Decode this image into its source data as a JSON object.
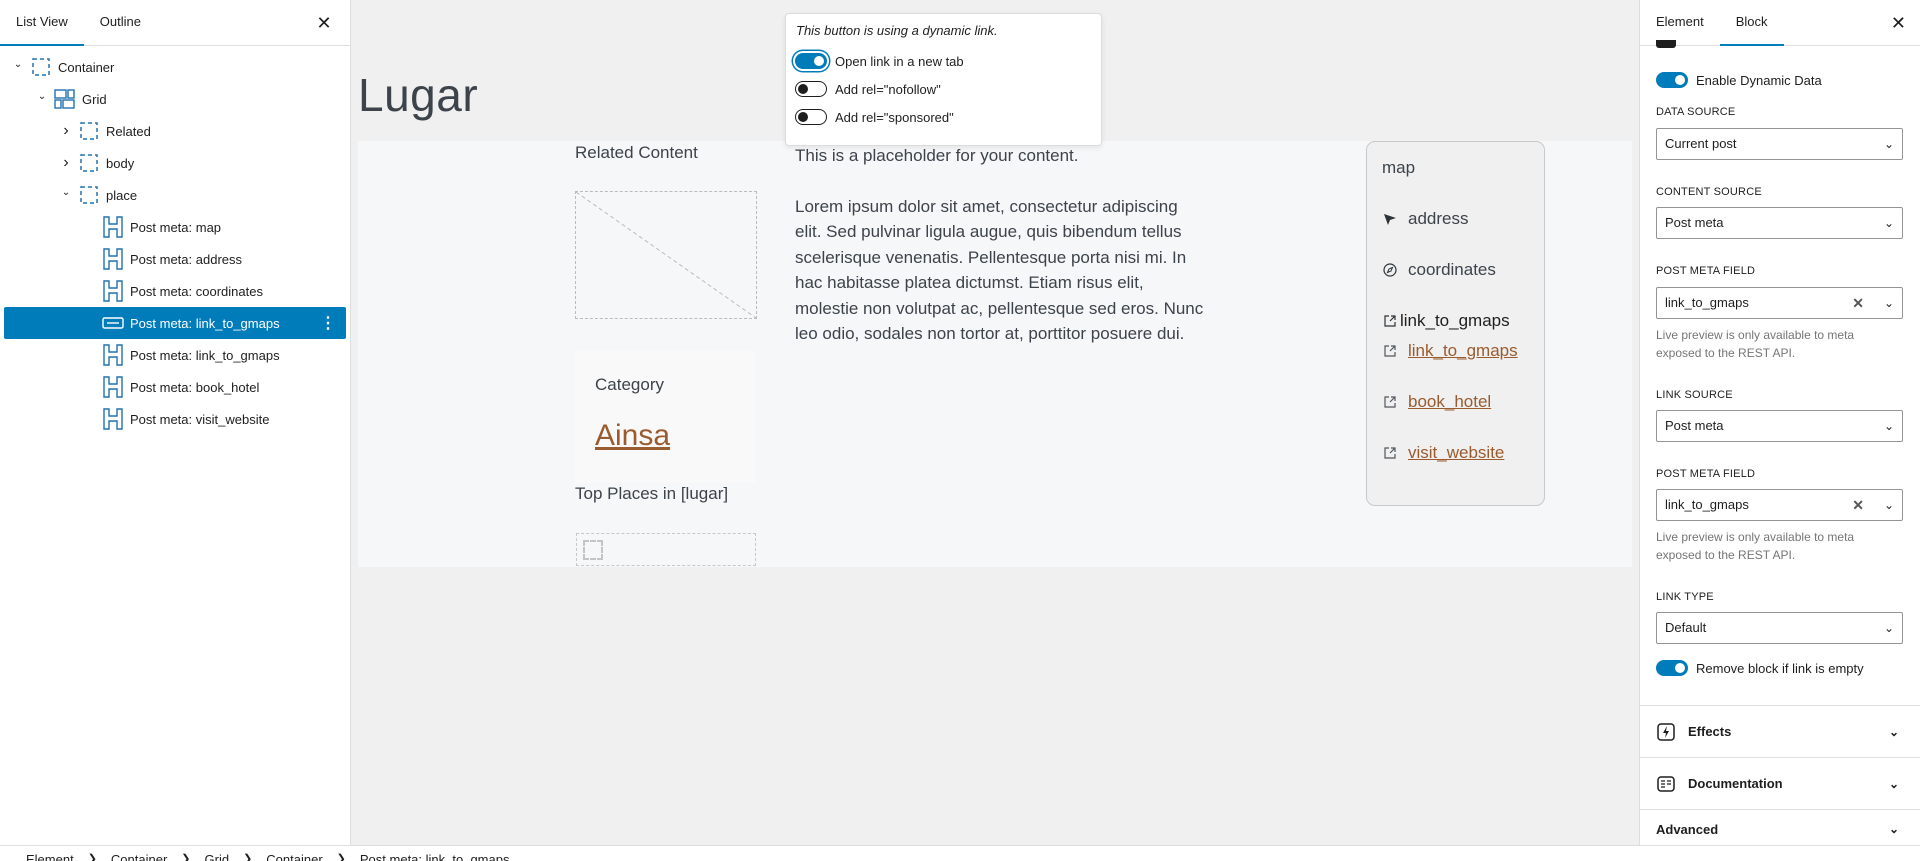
{
  "list_view": {
    "tabs": [
      {
        "label": "List View",
        "active": true
      },
      {
        "label": "Outline",
        "active": false
      }
    ],
    "close_icon": "close-icon",
    "tree": [
      {
        "label": "Container",
        "depth": 0,
        "toggle": "expanded",
        "icon": "container-icon"
      },
      {
        "label": "Grid",
        "depth": 1,
        "toggle": "expanded",
        "icon": "grid-icon"
      },
      {
        "label": "Related",
        "depth": 2,
        "toggle": "collapsed",
        "icon": "container-icon"
      },
      {
        "label": "body",
        "depth": 2,
        "toggle": "collapsed",
        "icon": "container-icon"
      },
      {
        "label": "place",
        "depth": 2,
        "toggle": "expanded",
        "icon": "container-icon"
      },
      {
        "label": "Post meta: map",
        "depth": 3,
        "icon": "heading-icon"
      },
      {
        "label": "Post meta: address",
        "depth": 3,
        "icon": "heading-icon"
      },
      {
        "label": "Post meta: coordinates",
        "depth": 3,
        "icon": "heading-icon"
      },
      {
        "label": "Post meta: link_to_gmaps",
        "depth": 3,
        "icon": "button-icon",
        "selected": true
      },
      {
        "label": "Post meta: link_to_gmaps",
        "depth": 3,
        "icon": "heading-icon"
      },
      {
        "label": "Post meta: book_hotel",
        "depth": 3,
        "icon": "heading-icon"
      },
      {
        "label": "Post meta: visit_website",
        "depth": 3,
        "icon": "heading-icon"
      }
    ]
  },
  "breadcrumb": [
    "Element",
    "Container",
    "Grid",
    "Container",
    "Post meta: link_to_gmaps"
  ],
  "canvas": {
    "page_title": "Lugar",
    "related_title": "Related Content",
    "category_label": "Category",
    "category_link": "Ainsa",
    "top_places": "Top Places in [lugar]",
    "body_paragraphs": [
      "This is a placeholder for your content.",
      "Lorem ipsum dolor sit amet, consectetur adipiscing elit. Sed pulvinar ligula augue, quis bibendum tellus scelerisque venenatis. Pellentesque porta nisi mi. In hac habitasse platea dictumst. Etiam risus elit, molestie non volutpat ac, pellentesque sed eros. Nunc leo odio, sodales non tortor at, porttitor posuere dui."
    ],
    "map_card": {
      "title": "map",
      "items": [
        {
          "label": "address",
          "icon": "location-arrow-icon",
          "link": false
        },
        {
          "label": "coordinates",
          "icon": "compass-icon",
          "link": false
        },
        {
          "label": "link_to_gmaps",
          "icon": "external-link-icon",
          "link": false
        },
        {
          "label": "link_to_gmaps",
          "icon": "external-link-icon",
          "link": true
        },
        {
          "label": "book_hotel",
          "icon": "external-link-icon",
          "link": true
        },
        {
          "label": "visit_website",
          "icon": "external-link-icon",
          "link": true
        }
      ]
    },
    "link_color": "#9a5b2e"
  },
  "popover": {
    "note": "This button is using a dynamic link.",
    "options": [
      {
        "label": "Open link in a new tab",
        "on": true
      },
      {
        "label": "Add rel=\"nofollow\"",
        "on": false
      },
      {
        "label": "Add rel=\"sponsored\"",
        "on": false
      }
    ]
  },
  "settings": {
    "tabs": [
      {
        "label": "Element",
        "active": false
      },
      {
        "label": "Block",
        "active": true
      }
    ],
    "enable_dynamic": {
      "label": "Enable Dynamic Data",
      "on": true
    },
    "data_source": {
      "label": "DATA SOURCE",
      "value": "Current post"
    },
    "content_source": {
      "label": "CONTENT SOURCE",
      "value": "Post meta"
    },
    "content_meta_field": {
      "label": "POST META FIELD",
      "value": "link_to_gmaps",
      "help": "Live preview is only available to meta exposed to the REST API."
    },
    "link_source": {
      "label": "LINK SOURCE",
      "value": "Post meta"
    },
    "link_meta_field": {
      "label": "POST META FIELD",
      "value": "link_to_gmaps",
      "help": "Live preview is only available to meta exposed to the REST API."
    },
    "link_type": {
      "label": "LINK TYPE",
      "value": "Default"
    },
    "remove_if_empty": {
      "label": "Remove block if link is empty",
      "on": true
    },
    "sections": [
      {
        "label": "Effects",
        "icon": "lightning-icon"
      },
      {
        "label": "Documentation",
        "icon": "book-icon"
      },
      {
        "label": "Advanced",
        "icon": ""
      }
    ]
  },
  "accent_color": "#007cba"
}
